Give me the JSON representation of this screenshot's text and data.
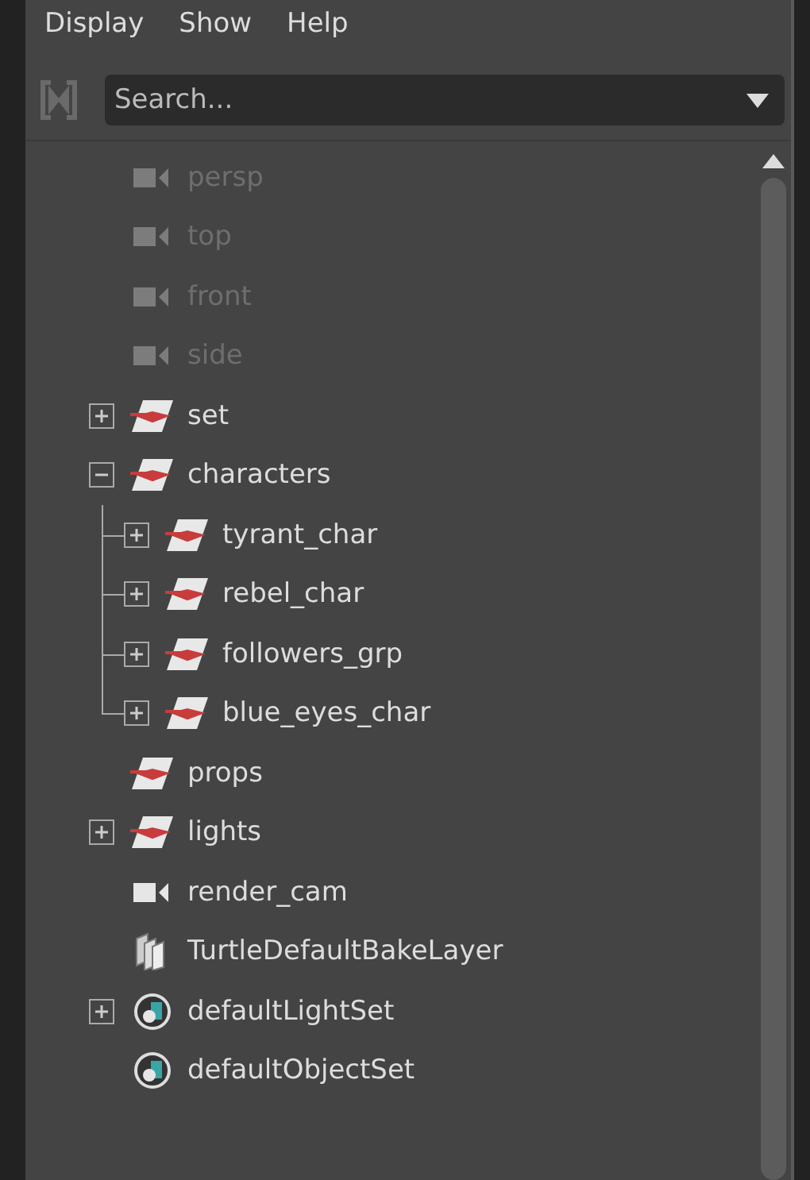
{
  "menu": [
    "Display",
    "Show",
    "Help"
  ],
  "search": {
    "placeholder": "Search..."
  },
  "tree": [
    {
      "label": "persp",
      "kind": "camera",
      "dimmed": true
    },
    {
      "label": "top",
      "kind": "camera",
      "dimmed": true
    },
    {
      "label": "front",
      "kind": "camera",
      "dimmed": true
    },
    {
      "label": "side",
      "kind": "camera",
      "dimmed": true
    },
    {
      "label": "set",
      "kind": "transform",
      "dimmed": false,
      "expanded": false
    },
    {
      "label": "characters",
      "kind": "transform",
      "dimmed": false,
      "expanded": true,
      "children": [
        {
          "label": "tyrant_char",
          "kind": "transform",
          "dimmed": false,
          "expanded": false
        },
        {
          "label": "rebel_char",
          "kind": "transform",
          "dimmed": false,
          "expanded": false
        },
        {
          "label": "followers_grp",
          "kind": "transform",
          "dimmed": false,
          "expanded": false
        },
        {
          "label": "blue_eyes_char",
          "kind": "transform",
          "dimmed": false,
          "expanded": false
        }
      ]
    },
    {
      "label": "props",
      "kind": "transform",
      "dimmed": false
    },
    {
      "label": "lights",
      "kind": "transform",
      "dimmed": false,
      "expanded": false
    },
    {
      "label": "render_cam",
      "kind": "camera",
      "dimmed": false
    },
    {
      "label": "TurtleDefaultBakeLayer",
      "kind": "layer",
      "dimmed": false
    },
    {
      "label": "defaultLightSet",
      "kind": "set",
      "dimmed": false,
      "expanded": false
    },
    {
      "label": "defaultObjectSet",
      "kind": "set",
      "dimmed": false
    }
  ]
}
